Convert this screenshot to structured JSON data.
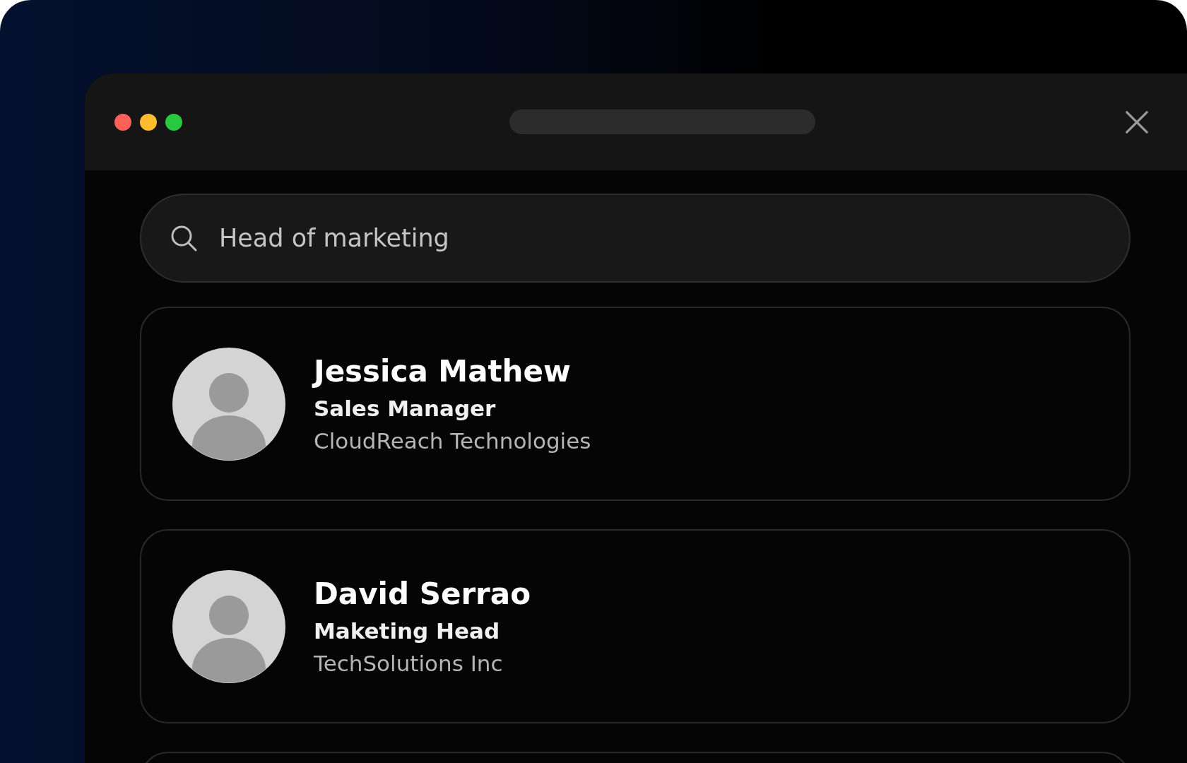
{
  "search": {
    "value": "Head of marketing"
  },
  "people": [
    {
      "name": "Jessica Mathew",
      "role": "Sales Manager",
      "company": "CloudReach Technologies"
    },
    {
      "name": "David Serrao",
      "role": "Maketing Head",
      "company": "TechSolutions Inc"
    }
  ]
}
